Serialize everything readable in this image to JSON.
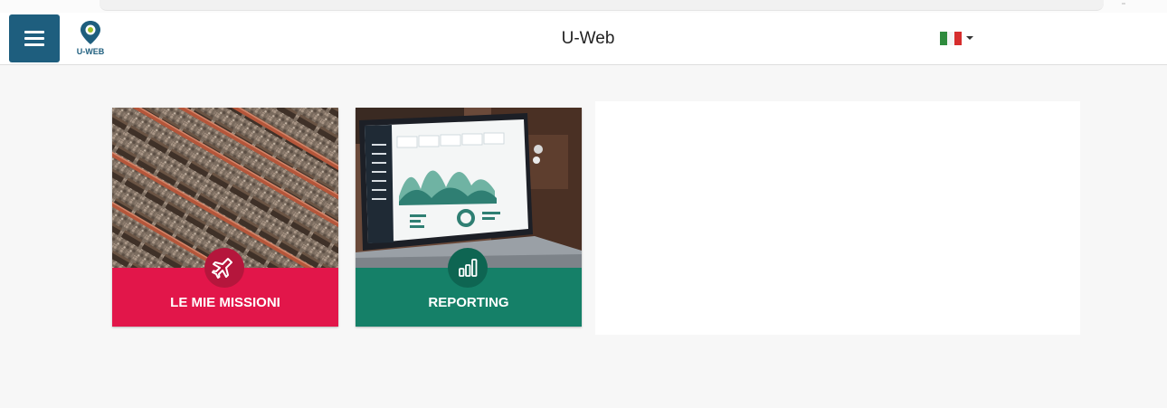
{
  "header": {
    "title": "U-Web",
    "logo_text": "U-WEB",
    "language": "Italiano",
    "menu_icon": "hamburger-icon"
  },
  "tiles": [
    {
      "label": "LE MIE MISSIONI",
      "icon": "airplane-icon",
      "image": "railway-tracks",
      "color": "#e2164a"
    },
    {
      "label": "REPORTING",
      "icon": "bar-chart-icon",
      "image": "laptop-dashboard",
      "color": "#158068"
    }
  ],
  "colors": {
    "primary": "#1e5e7e",
    "missioni": "#e2164a",
    "reporting": "#158068",
    "accent_green": "#9bbf2a"
  }
}
